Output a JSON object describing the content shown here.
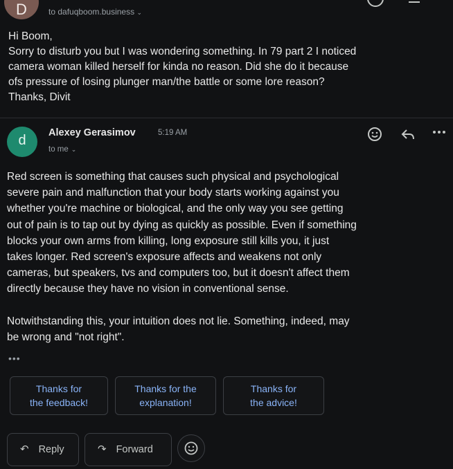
{
  "previous_message": {
    "avatar_letter": "D",
    "to_line": "to dafuqboom.business",
    "body_lines": [
      "Hi Boom,",
      "Sorry to disturb you but I was wondering something. In 79 part 2 I noticed",
      "camera woman killed herself for kinda no reason. Did she do it because",
      "ofs pressure of losing plunger man/the battle or some lore reason?",
      "Thanks, Divit"
    ]
  },
  "message": {
    "avatar_letter": "d",
    "avatar_color": "#1e8a6e",
    "sender": "Alexey Gerasimov",
    "time": "5:19 AM",
    "to_line": "to me",
    "paragraph1": [
      "Red screen is something that causes such physical and psychological",
      "severe pain and malfunction that your body starts working against you",
      "whether you're machine or biological, and the only way you see getting",
      "out of pain is to tap out by dying as quickly as possible. Even if something",
      "blocks your own arms from killing, long exposure still kills you, it just",
      "takes longer. Red screen's exposure affects and weakens not only",
      "cameras, but speakers, tvs and computers too, but it doesn't affect them",
      "directly because they have no vision in conventional sense."
    ],
    "paragraph2": [
      "Notwithstanding this, your intuition does not lie. Something, indeed, may",
      "be wrong and \"not right\"."
    ],
    "trimmed_indicator": "•••"
  },
  "smart_replies": [
    {
      "line1": "Thanks for",
      "line2": "the feedback!"
    },
    {
      "line1": "Thanks for the",
      "line2": "explanation!"
    },
    {
      "line1": "Thanks for",
      "line2": "the advice!"
    }
  ],
  "actions": {
    "reply_label": "Reply",
    "forward_label": "Forward"
  },
  "icons": {
    "header_icons": [
      "emoji-icon",
      "reply-icon",
      "more-options-icon"
    ],
    "action_icons": [
      "reply-arrow-icon",
      "forward-arrow-icon",
      "emoji-icon"
    ]
  },
  "colors": {
    "background": "#111214",
    "accent_link": "#8ab4f8",
    "muted_text": "#9aa0a6"
  }
}
